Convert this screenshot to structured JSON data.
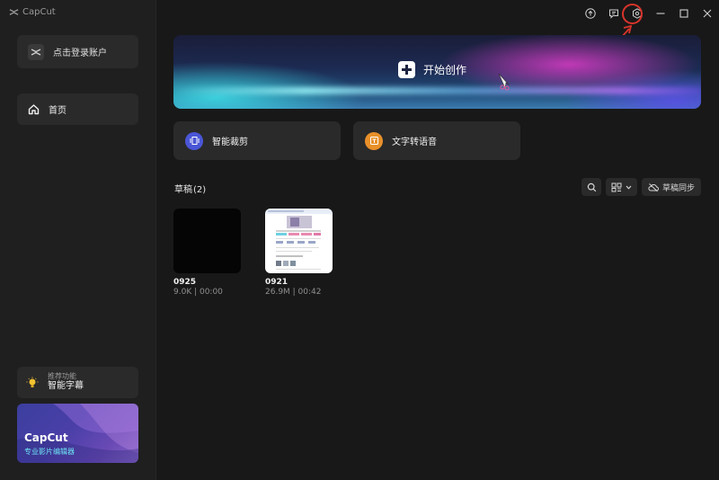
{
  "app": {
    "logo_text": "CapCut"
  },
  "sidebar": {
    "login_label": "点击登录账户",
    "home_label": "首页",
    "feature": {
      "subtitle": "推荐功能",
      "title": "智能字幕"
    },
    "promo": {
      "title": "CapCut",
      "subtitle": "专业影片编辑器"
    }
  },
  "hero": {
    "label": "开始创作"
  },
  "tools": [
    {
      "label": "智能裁剪",
      "icon": "smart-crop-icon",
      "color": "#4a56d6"
    },
    {
      "label": "文字转语音",
      "icon": "text-to-speech-icon",
      "color": "#e8902a"
    }
  ],
  "drafts": {
    "title": "草稿",
    "count": "(2)",
    "sync_label": "草稿同步",
    "items": [
      {
        "name": "0925",
        "meta": "9.0K | 00:00"
      },
      {
        "name": "0921",
        "meta": "26.9M | 00:42"
      }
    ]
  },
  "window_controls": [
    "upload-icon",
    "feedback-icon",
    "settings-icon",
    "minimize-icon",
    "maximize-icon",
    "close-icon"
  ],
  "colors": {
    "accent_ring": "#d9342b",
    "sidebar_bg": "#1f1f1f",
    "main_bg": "#181818"
  }
}
